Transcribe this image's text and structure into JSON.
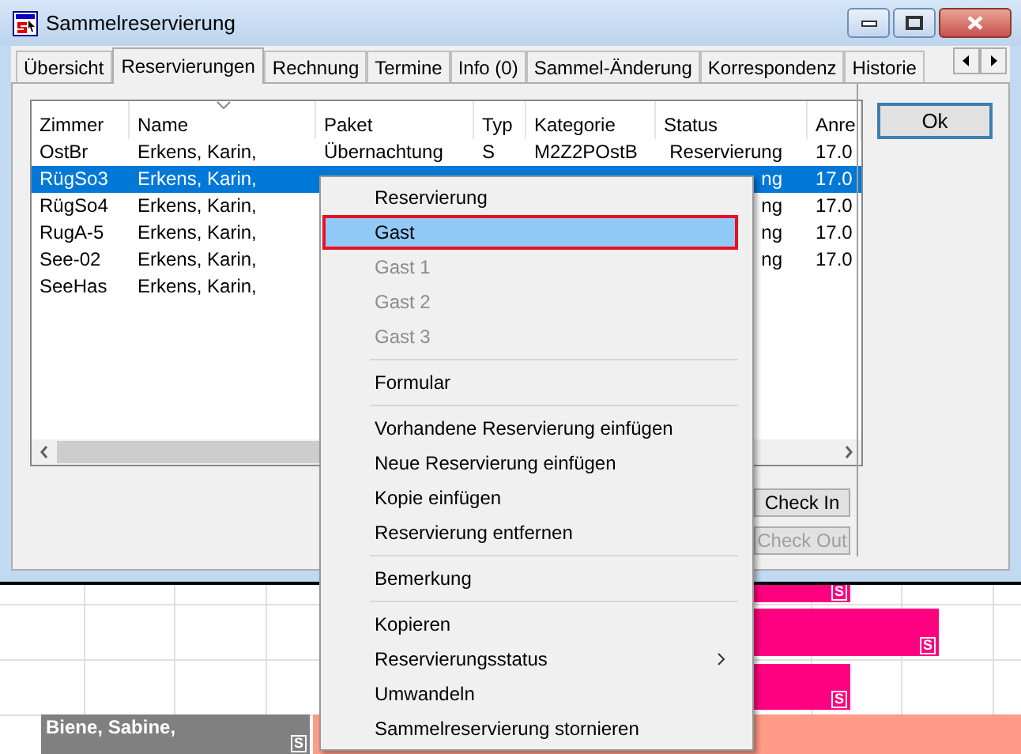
{
  "window": {
    "title": "Sammelreservierung"
  },
  "tabs": [
    {
      "label": "Übersicht",
      "selected": false
    },
    {
      "label": "Reservierungen",
      "selected": true
    },
    {
      "label": "Rechnung",
      "selected": false
    },
    {
      "label": "Termine",
      "selected": false
    },
    {
      "label": "Info (0)",
      "selected": false
    },
    {
      "label": "Sammel-Änderung",
      "selected": false
    },
    {
      "label": "Korrespondenz",
      "selected": false
    },
    {
      "label": "Historie",
      "selected": false
    }
  ],
  "table": {
    "columns": [
      {
        "label": "Zimmer",
        "sorted": false
      },
      {
        "label": "Name",
        "sorted": true
      },
      {
        "label": "Paket",
        "sorted": false
      },
      {
        "label": "Typ",
        "sorted": false
      },
      {
        "label": "Kategorie",
        "sorted": false
      },
      {
        "label": "Status",
        "sorted": false
      },
      {
        "label": "Anre",
        "sorted": false
      }
    ],
    "rows": [
      {
        "selected": false,
        "cells": [
          "OstBr",
          "Erkens, Karin,",
          "Übernachtung",
          "S",
          "M2Z2POstB",
          "Reservierung",
          "17.0"
        ]
      },
      {
        "selected": true,
        "cells": [
          "RügSo3",
          "Erkens, Karin,",
          null,
          null,
          null,
          "ng",
          "17.0"
        ]
      },
      {
        "selected": false,
        "cells": [
          "RügSo4",
          "Erkens, Karin,",
          null,
          null,
          null,
          "ng",
          "17.0"
        ]
      },
      {
        "selected": false,
        "cells": [
          "RugA-5",
          "Erkens, Karin,",
          null,
          null,
          null,
          "ng",
          "17.0"
        ]
      },
      {
        "selected": false,
        "cells": [
          "See-02",
          "Erkens, Karin,",
          null,
          null,
          null,
          "ng",
          "17.0"
        ]
      },
      {
        "selected": false,
        "cells": [
          "SeeHas",
          "Erkens, Karin,",
          null,
          null,
          null,
          null,
          null
        ]
      }
    ]
  },
  "buttons": [
    {
      "label": "Ok",
      "disabled": false,
      "default": true
    },
    {
      "label": "Check In",
      "disabled": false,
      "default": false
    },
    {
      "label": "Check Out",
      "disabled": true,
      "default": false
    }
  ],
  "context_menu": [
    {
      "kind": "item",
      "label": "Reservierung",
      "disabled": false,
      "selected": false,
      "submenu": false
    },
    {
      "kind": "item",
      "label": "Gast",
      "disabled": false,
      "selected": true,
      "submenu": false
    },
    {
      "kind": "item",
      "label": "Gast 1",
      "disabled": true,
      "selected": false,
      "submenu": false
    },
    {
      "kind": "item",
      "label": "Gast 2",
      "disabled": true,
      "selected": false,
      "submenu": false
    },
    {
      "kind": "item",
      "label": "Gast 3",
      "disabled": true,
      "selected": false,
      "submenu": false
    },
    {
      "kind": "separator"
    },
    {
      "kind": "item",
      "label": "Formular",
      "disabled": false,
      "selected": false,
      "submenu": false
    },
    {
      "kind": "separator"
    },
    {
      "kind": "item",
      "label": "Vorhandene Reservierung einfügen",
      "disabled": false,
      "selected": false,
      "submenu": false
    },
    {
      "kind": "item",
      "label": "Neue Reservierung einfügen",
      "disabled": false,
      "selected": false,
      "submenu": false
    },
    {
      "kind": "item",
      "label": "Kopie einfügen",
      "disabled": false,
      "selected": false,
      "submenu": false
    },
    {
      "kind": "item",
      "label": "Reservierung entfernen",
      "disabled": false,
      "selected": false,
      "submenu": false
    },
    {
      "kind": "separator"
    },
    {
      "kind": "item",
      "label": "Bemerkung",
      "disabled": false,
      "selected": false,
      "submenu": false
    },
    {
      "kind": "separator"
    },
    {
      "kind": "item",
      "label": "Kopieren",
      "disabled": false,
      "selected": false,
      "submenu": false
    },
    {
      "kind": "item",
      "label": "Reservierungsstatus",
      "disabled": false,
      "selected": false,
      "submenu": true
    },
    {
      "kind": "item",
      "label": "Umwandeln",
      "disabled": false,
      "selected": false,
      "submenu": false
    },
    {
      "kind": "item",
      "label": "Sammelreservierung stornieren",
      "disabled": false,
      "selected": false,
      "submenu": false
    }
  ],
  "calendar": {
    "bars": [
      {
        "color": "#ff0080",
        "marker": "S"
      },
      {
        "color": "#ff0080",
        "marker": "S"
      },
      {
        "color": "#ff0080",
        "marker": "S"
      },
      {
        "label": "Biene, Sabine,",
        "color": "#808080",
        "marker": "S"
      },
      {
        "color": "#ff9b87"
      }
    ]
  }
}
